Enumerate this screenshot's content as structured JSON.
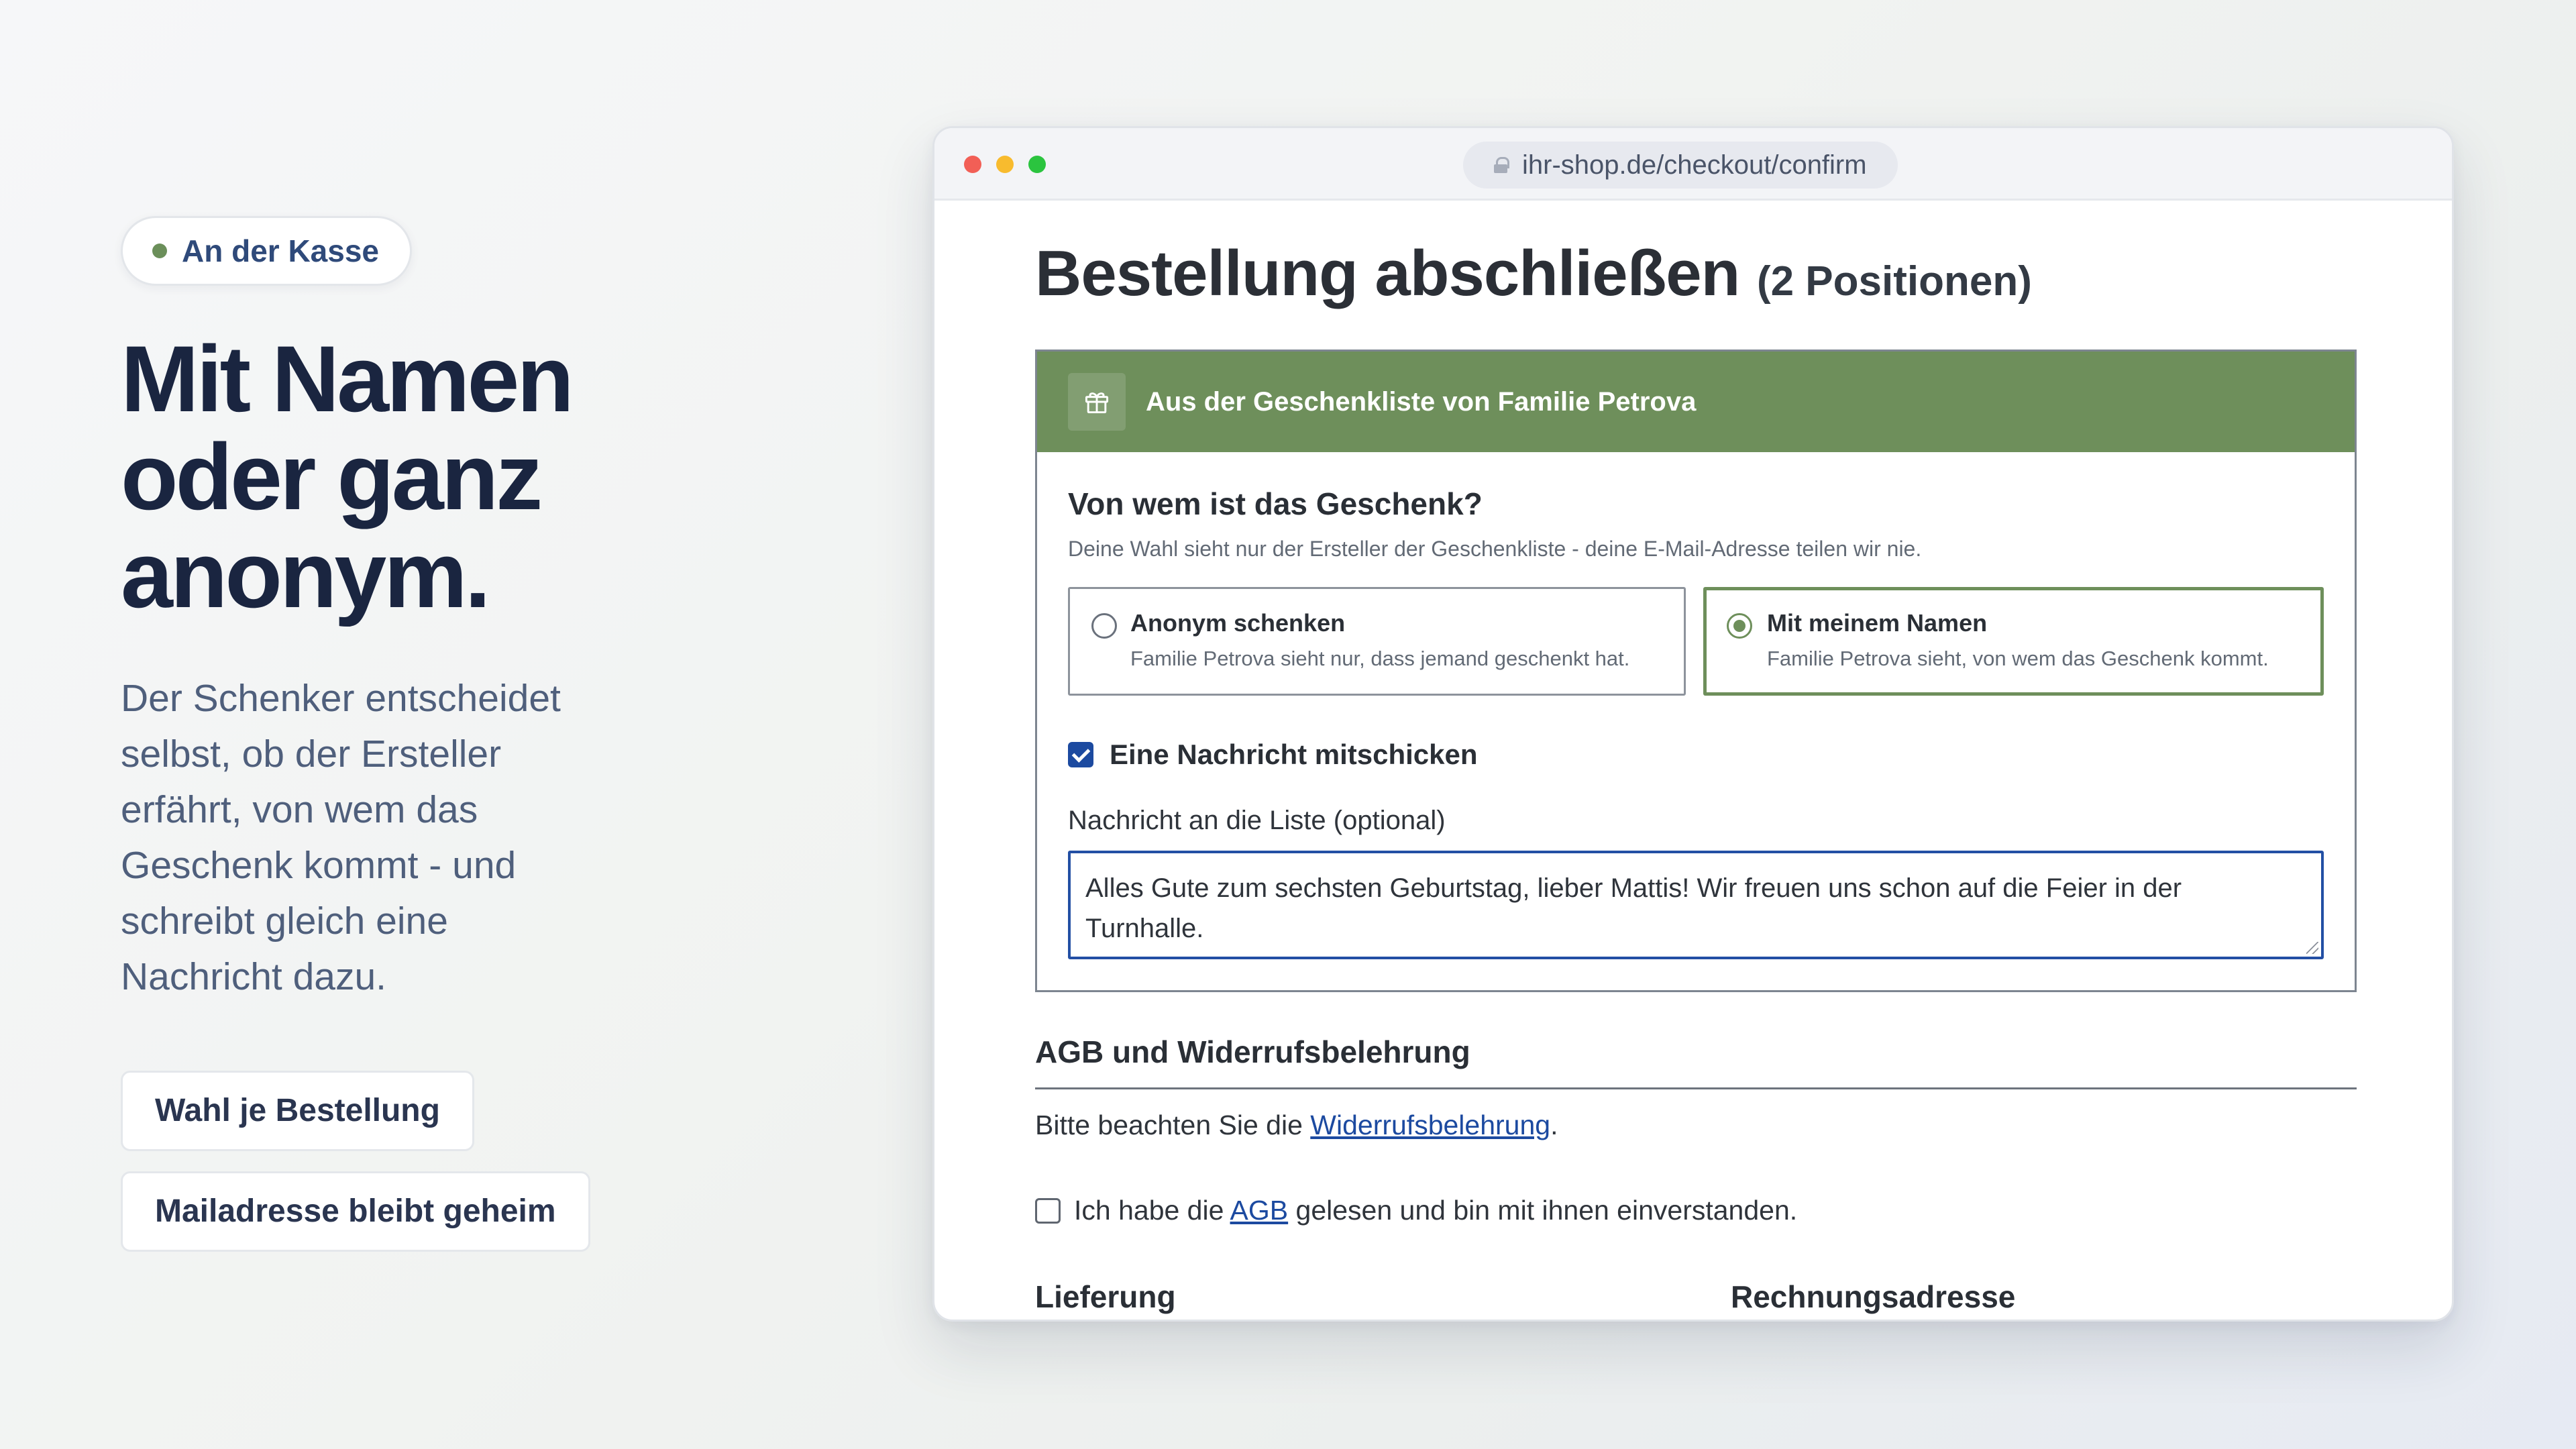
{
  "hero": {
    "badge": "An der Kasse",
    "headline": "Mit Namen\noder ganz\nanonym.",
    "lede": "Der Schenker entscheidet selbst, ob der Ersteller erfährt, von wem das Geschenk kommt - und schreibt gleich eine Nachricht dazu.",
    "chips": [
      "Wahl je Bestellung",
      "Mailadresse bleibt geheim"
    ]
  },
  "browser": {
    "url": "ihr-shop.de/checkout/confirm"
  },
  "checkout": {
    "title": "Bestellung abschließen",
    "count": "(2 Positionen)",
    "gift_banner": "Aus der Geschenkliste von Familie Petrova",
    "question": "Von wem ist das Geschenk?",
    "question_sub": "Deine Wahl sieht nur der Ersteller der Geschenkliste - deine E-Mail-Adresse teilen wir nie.",
    "options": [
      {
        "label": "Anonym schenken",
        "sub": "Familie Petrova sieht nur, dass jemand geschenkt hat.",
        "selected": false
      },
      {
        "label": "Mit meinem Namen",
        "sub": "Familie Petrova sieht, von wem das Geschenk kommt.",
        "selected": true
      }
    ],
    "message_checkbox": "Eine Nachricht mitschicken",
    "message_checked": true,
    "message_label": "Nachricht an die Liste (optional)",
    "message_value": "Alles Gute zum sechsten Geburtstag, lieber Mattis! Wir freuen uns schon auf die Feier in der Turnhalle.",
    "agb_title": "AGB und Widerrufsbelehrung",
    "agb_text_before": "Bitte beachten Sie die ",
    "agb_link": "Widerrufsbelehrung",
    "agb_text_after": ".",
    "agb_check_before": "Ich habe die ",
    "agb_check_link": "AGB",
    "agb_check_after": " gelesen und bin mit ihnen einverstanden.",
    "agb_checked": false,
    "col_delivery": "Lieferung",
    "col_billing": "Rechnungsadresse"
  },
  "colors": {
    "accent_green": "#6e8f5b",
    "link_blue": "#1c4aa0",
    "heading_navy": "#1a2540"
  },
  "icons": {
    "gift": "gift-icon",
    "lock": "lock-icon"
  }
}
